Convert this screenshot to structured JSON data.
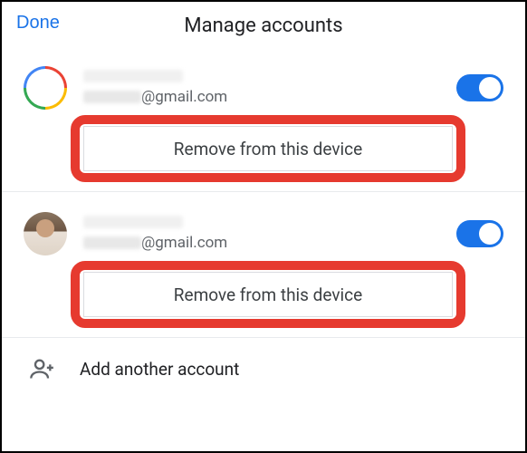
{
  "header": {
    "done_label": "Done",
    "title": "Manage accounts"
  },
  "accounts": [
    {
      "email_suffix": "@gmail.com",
      "toggle_on": true,
      "remove_label": "Remove from this device"
    },
    {
      "email_suffix": "@gmail.com",
      "toggle_on": true,
      "remove_label": "Remove from this device"
    }
  ],
  "add_account_label": "Add another account"
}
